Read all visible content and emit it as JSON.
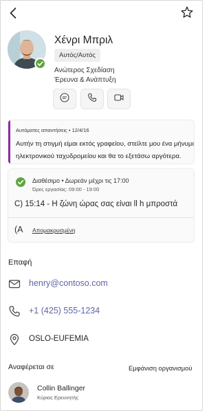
{
  "header": {
    "back_icon": "chevron-left-icon",
    "favorite_icon": "star-outline-icon"
  },
  "profile": {
    "name": "Χένρι Μπριλ",
    "pronouns": "Αυτός/Αυτός",
    "job_title": "Ανώτερος Σχεδίαση",
    "department": "Έρευνα & Ανάπτυξη",
    "presence_color": "#5ea73f"
  },
  "actions": {
    "chat_icon": "chat-icon",
    "call_icon": "phone-icon",
    "video_icon": "video-icon"
  },
  "out_of_office": {
    "header": "Αυτόματες απαντήσεις • 12/4/16",
    "message": "Αυτήν τη στιγμή είμαι εκτός γραφείου, στείλτε μου ένα μήνυμα ηλεκτρονικού ταχυδρομείου και θα το εξετάσω αργότερα.",
    "accent_color": "#8d2ba3"
  },
  "availability": {
    "status": "Διαθέσιμο • Δωρεάν μέχρι τις 17:00",
    "work_hours": "Ώρες εργασίας: 09:00 - 19:00",
    "local_time": "C) 15:14 - Η ζώνη ώρας σας είναι ll h μπροστά",
    "location_glyph": "(A",
    "location_mode": "Απομακρυσμένη"
  },
  "contact": {
    "section_title": "Επαφή",
    "email": "henry@contoso.com",
    "phone": "+1 (425) 555-1234",
    "office": "OSLO-EUFEMIA",
    "link_color": "#6264a7"
  },
  "reports_to": {
    "label": "Αναφέρεται σε",
    "org_link": "Εμφάνιση οργανισμού",
    "manager_name": "Collin Ballinger",
    "manager_title": "Κύριος Ερευνητής"
  }
}
